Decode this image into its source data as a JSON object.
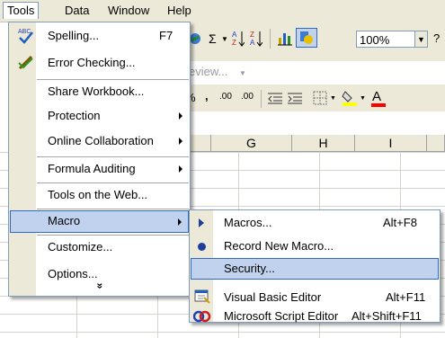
{
  "menubar": {
    "items": [
      "Tools",
      "Data",
      "Window",
      "Help"
    ]
  },
  "toolbar": {
    "zoom_value": "100%",
    "sigma_glyph": "Σ",
    "review_text": "eview...",
    "percent_glyph": "%",
    "comma_glyph": ",",
    "inc_decimal": ".00",
    "dec_decimal": ".00"
  },
  "columns": [
    "G",
    "H",
    "I"
  ],
  "tools_menu": {
    "items": [
      {
        "label": "Spelling...",
        "shortcut": "F7",
        "icon": "spelling-icon"
      },
      {
        "label": "Error Checking...",
        "icon": "error-checking-icon"
      },
      {
        "label": "Share Workbook..."
      },
      {
        "label": "Protection",
        "submenu": true
      },
      {
        "label": "Online Collaboration",
        "submenu": true
      },
      {
        "label": "Formula Auditing",
        "submenu": true
      },
      {
        "label": "Tools on the Web..."
      },
      {
        "label": "Macro",
        "submenu": true,
        "highlighted": true
      },
      {
        "label": "Customize..."
      },
      {
        "label": "Options..."
      }
    ],
    "more_glyph": "»"
  },
  "macro_menu": {
    "items": [
      {
        "label": "Macros...",
        "shortcut": "Alt+F8",
        "icon": "play-arrow-icon"
      },
      {
        "label": "Record New Macro...",
        "icon": "record-dot-icon"
      },
      {
        "label": "Security...",
        "highlighted": true
      },
      {
        "label": "Visual Basic Editor",
        "shortcut": "Alt+F11",
        "icon": "vb-editor-icon"
      },
      {
        "label": "Microsoft Script Editor",
        "shortcut": "Alt+Shift+F11",
        "icon": "script-editor-icon"
      }
    ]
  }
}
